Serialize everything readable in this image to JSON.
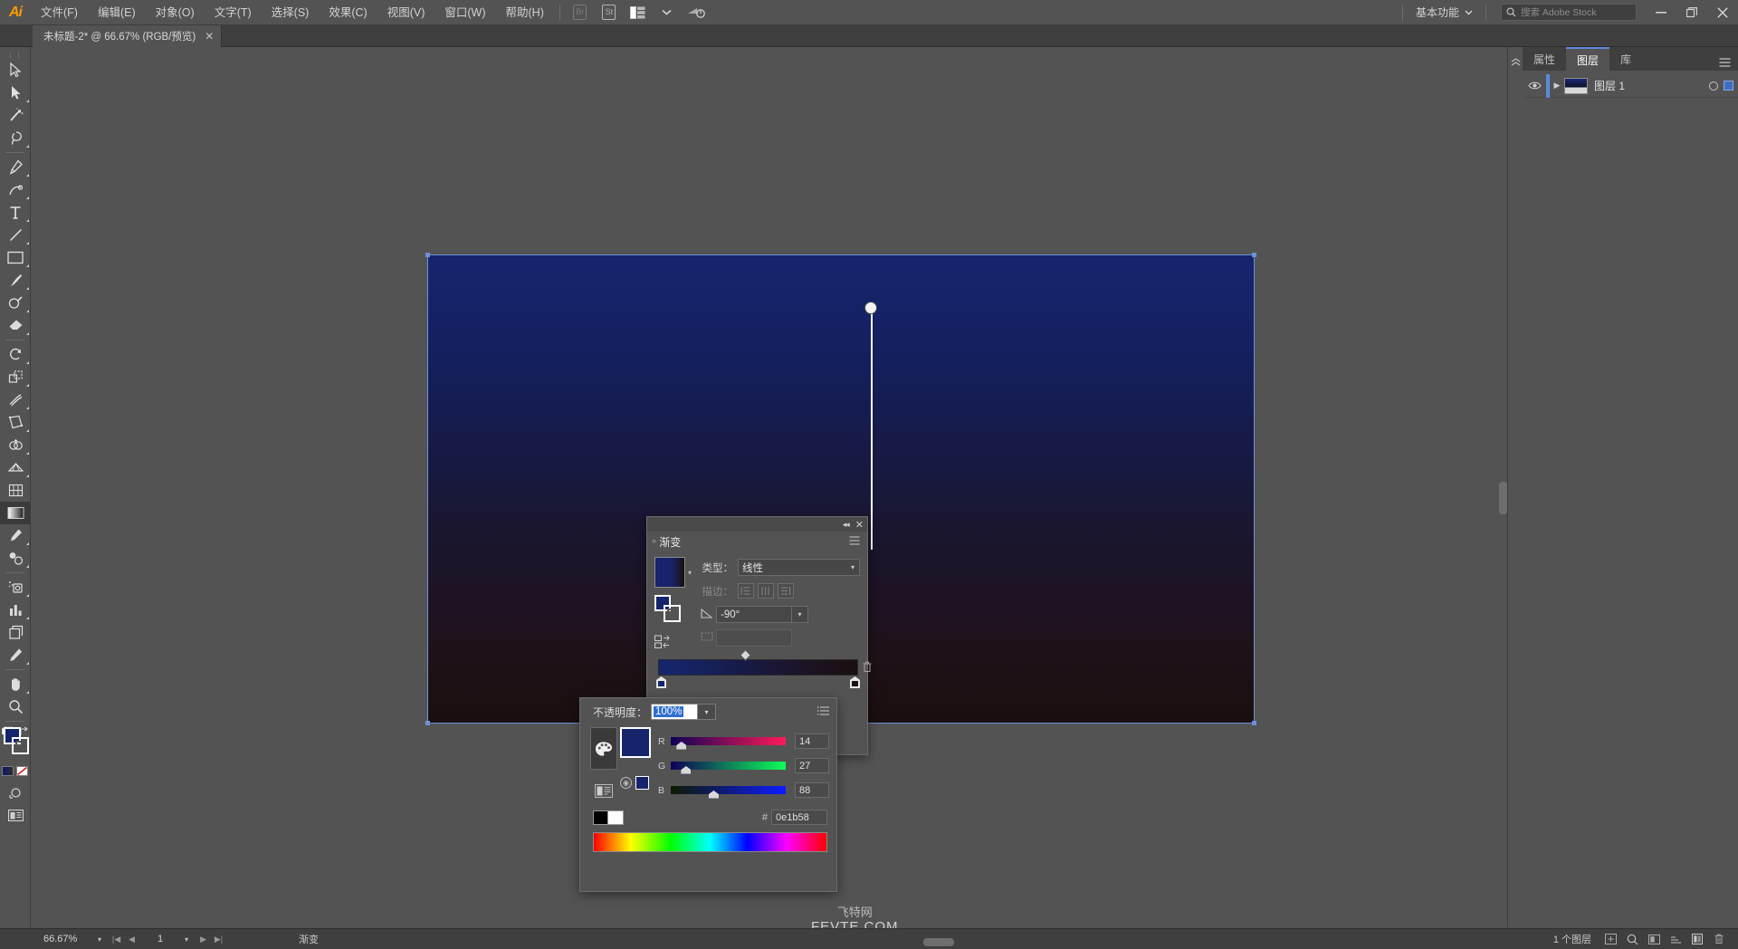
{
  "app": {
    "logo": "Ai",
    "menus": [
      "文件(F)",
      "编辑(E)",
      "对象(O)",
      "文字(T)",
      "选择(S)",
      "效果(C)",
      "视图(V)",
      "窗口(W)",
      "帮助(H)"
    ],
    "toolbar_icons": [
      "bridge-icon",
      "stock-icon",
      "arrange-documents-icon",
      "chevron-down-icon",
      "illustrator-power-icon"
    ],
    "workspace": "基本功能",
    "search_placeholder": "搜索 Adobe Stock",
    "window_buttons": [
      "minimize-button",
      "restore-button",
      "close-button"
    ]
  },
  "document_tab": {
    "title": "未标题-2* @ 66.67% (RGB/预览)",
    "close": "✕"
  },
  "tools": [
    {
      "name": "selection-tool",
      "glyph": "selection"
    },
    {
      "name": "direct-selection-tool",
      "glyph": "direct"
    },
    {
      "name": "magic-wand-tool",
      "glyph": "wand"
    },
    {
      "name": "lasso-tool",
      "glyph": "lasso"
    },
    {
      "name": "pen-tool",
      "glyph": "pen"
    },
    {
      "name": "curvature-tool",
      "glyph": "curv"
    },
    {
      "name": "type-tool",
      "glyph": "type"
    },
    {
      "name": "line-segment-tool",
      "glyph": "line"
    },
    {
      "name": "rectangle-tool",
      "glyph": "rect"
    },
    {
      "name": "paintbrush-tool",
      "glyph": "brush"
    },
    {
      "name": "shaper-tool",
      "glyph": "shaper"
    },
    {
      "name": "eraser-tool",
      "glyph": "eraser"
    },
    {
      "name": "rotate-tool",
      "glyph": "rotate"
    },
    {
      "name": "scale-tool",
      "glyph": "scale"
    },
    {
      "name": "width-tool",
      "glyph": "width"
    },
    {
      "name": "free-transform-tool",
      "glyph": "freexf"
    },
    {
      "name": "shape-builder-tool",
      "glyph": "shapebuild"
    },
    {
      "name": "perspective-grid-tool",
      "glyph": "perspective"
    },
    {
      "name": "mesh-tool",
      "glyph": "mesh"
    },
    {
      "name": "gradient-tool",
      "glyph": "gradient",
      "active": true
    },
    {
      "name": "eyedropper-tool",
      "glyph": "eyedropper"
    },
    {
      "name": "blend-tool",
      "glyph": "blend"
    },
    {
      "name": "symbol-sprayer-tool",
      "glyph": "symbol"
    },
    {
      "name": "column-graph-tool",
      "glyph": "graph"
    },
    {
      "name": "artboard-tool",
      "glyph": "artboard"
    },
    {
      "name": "slice-tool",
      "glyph": "slice"
    },
    {
      "name": "hand-tool",
      "glyph": "hand"
    },
    {
      "name": "zoom-tool",
      "glyph": "zoom"
    }
  ],
  "fill_stroke": {
    "fill_color": "#16246b",
    "stroke_color": "none",
    "gradient_swatch": "#16246b",
    "none_swatch": "none"
  },
  "canvas": {
    "artboard_gradient_top": "#16246b",
    "artboard_gradient_bottom": "#1a0f0f",
    "selection_color": "#6f8fd8",
    "gradient_annotator": "gradient-annotator-line"
  },
  "watermark": {
    "cn": "飞特网",
    "en": "FEVTE.COM"
  },
  "gradient_panel": {
    "title": "渐变",
    "type_label": "类型：",
    "type_value": "线性",
    "stroke_label": "描边：",
    "angle_label": "angle-icon",
    "angle_value": "-90°",
    "aspect_label": "aspect-ratio-icon",
    "aspect_value": "",
    "stops": [
      {
        "position": 0,
        "color": "#16246b"
      },
      {
        "position": 100,
        "color": "#1a1010"
      }
    ],
    "midpoint": 50,
    "menu": "panel-menu-icon"
  },
  "color_panel": {
    "opacity_label": "不透明度：",
    "opacity_value": "100%",
    "swatch": "#16246b",
    "sliders": [
      {
        "name": "R",
        "value": "14",
        "from": "#0e0058",
        "to": "#ff1b58"
      },
      {
        "name": "G",
        "value": "27",
        "from": "#0e0058",
        "to": "#0eff58"
      },
      {
        "name": "B",
        "value": "88",
        "from": "#0e1b00",
        "to": "#0e1bff"
      }
    ],
    "hex_symbol": "#",
    "hex_value": "0e1b58",
    "black_swatch": "#000000",
    "white_swatch": "#ffffff",
    "icons": [
      "color-palette-icon",
      "color-guide-icon"
    ]
  },
  "right_panel": {
    "tabs": [
      {
        "label": "属性",
        "active": false
      },
      {
        "label": "图层",
        "active": true
      },
      {
        "label": "库",
        "active": false
      }
    ],
    "menu": "panel-menu-icon",
    "layers": [
      {
        "name": "图层 1",
        "visible": true,
        "selected": true
      }
    ]
  },
  "status_bar": {
    "zoom": "66.67%",
    "page": "1",
    "current_tool": "渐变",
    "layer_count": "1 个图层",
    "icons": [
      "new-layer-icon",
      "search-icon",
      "mask-icon",
      "nav-icon",
      "doc-icon",
      "trash-icon"
    ]
  }
}
